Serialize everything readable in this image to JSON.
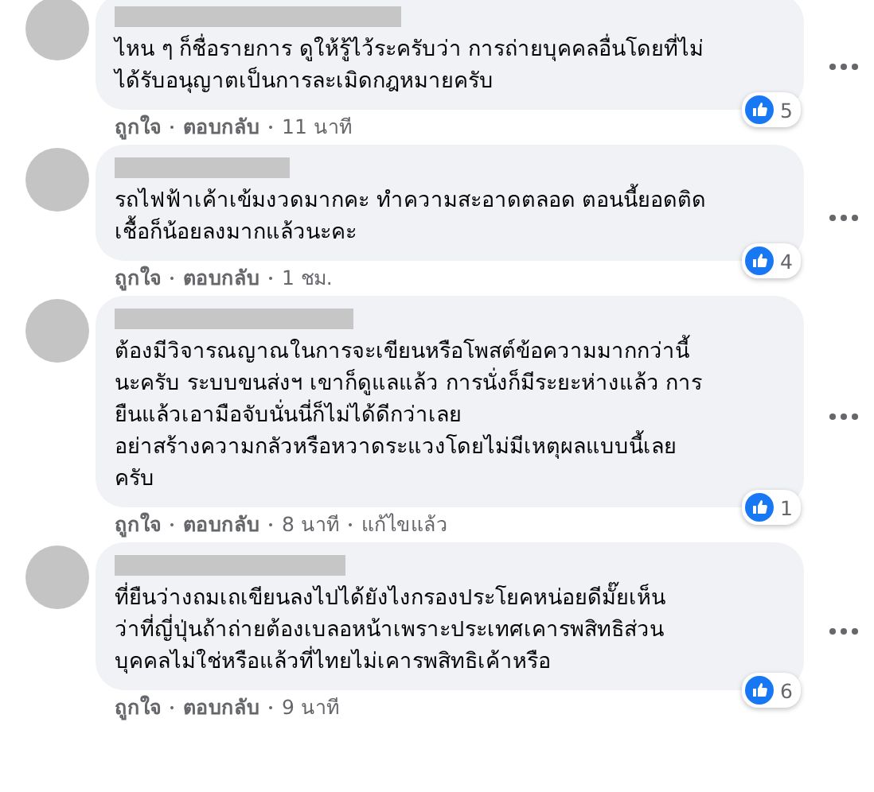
{
  "comments": [
    {
      "lines": [
        "ไหน ๆ ก็ชื่อรายการ ดูให้รู้ไว้ระครับว่า การถ่ายบุคคลอื่นโดยที่ไม่",
        "ได้รับอนุญาตเป็นการละเมิดกฎหมายครับ"
      ],
      "reactions": "5",
      "like": "ถูกใจ",
      "reply": "ตอบกลับ",
      "time": "11 นาที"
    },
    {
      "lines": [
        "รถไฟฟ้าเค้าเข้มงวดมากคะ ทำความสะอาดตลอด ตอนนี้ยอดติด",
        "เชื้อก็น้อยลงมากแล้วนะคะ"
      ],
      "reactions": "4",
      "like": "ถูกใจ",
      "reply": "ตอบกลับ",
      "time": "1 ชม."
    },
    {
      "lines": [
        "ต้องมีวิจารณญาณในการจะเขียนหรือโพสต์ข้อความมากกว่านี้",
        "นะครับ ระบบขนส่งฯ เขาก็ดูแลแล้ว การนั่งก็มีระยะห่างแล้ว การ",
        "ยืนแล้วเอามือจับนั่นนี่ก็ไม่ได้ดีกว่าเลย",
        "อย่าสร้างความกลัวหรือหวาดระแวงโดยไม่มีเหตุผลแบบนี้เลย",
        "ครับ"
      ],
      "reactions": "1",
      "like": "ถูกใจ",
      "reply": "ตอบกลับ",
      "time": "8 นาที",
      "edited": "แก้ไขแล้ว"
    },
    {
      "lines": [
        "ที่ยืนว่างถมเถเขียนลงไปได้ยังไงกรองประโยคหน่อยดีมั๊ยเห็น",
        "ว่าที่ญี่ปุ่นถ้าถ่ายต้องเบลอหน้าเพราะประเทศเคารพสิทธิส่วน",
        "บุคคลไม่ใช่หรือแล้วที่ไทยไม่เคารพสิทธิเค้าหรือ"
      ],
      "reactions": "6",
      "like": "ถูกใจ",
      "reply": "ตอบกลับ",
      "time": "9 นาที"
    }
  ]
}
